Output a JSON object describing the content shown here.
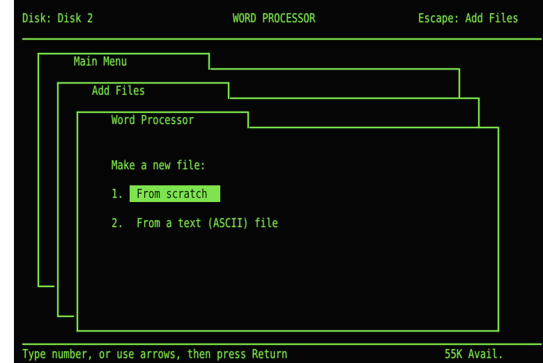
{
  "header": {
    "disk": "Disk: Disk 2",
    "title": "WORD PROCESSOR",
    "escape": "Escape: Add Files"
  },
  "tabs": {
    "main_menu": "Main Menu",
    "add_files": "Add Files",
    "word_processor": "Word Processor"
  },
  "content": {
    "prompt": "Make a new file:",
    "options": [
      {
        "number": "1.",
        "label": "From scratch",
        "selected": true
      },
      {
        "number": "2.",
        "label": "From a text (ASCII) file",
        "selected": false
      }
    ]
  },
  "footer": {
    "instructions": "Type number, or use arrows, then press Return",
    "memory": "55K Avail."
  },
  "colors": {
    "phosphor": "#7ee34e",
    "background": "#050505",
    "highlight_text": "#0b1a06"
  }
}
